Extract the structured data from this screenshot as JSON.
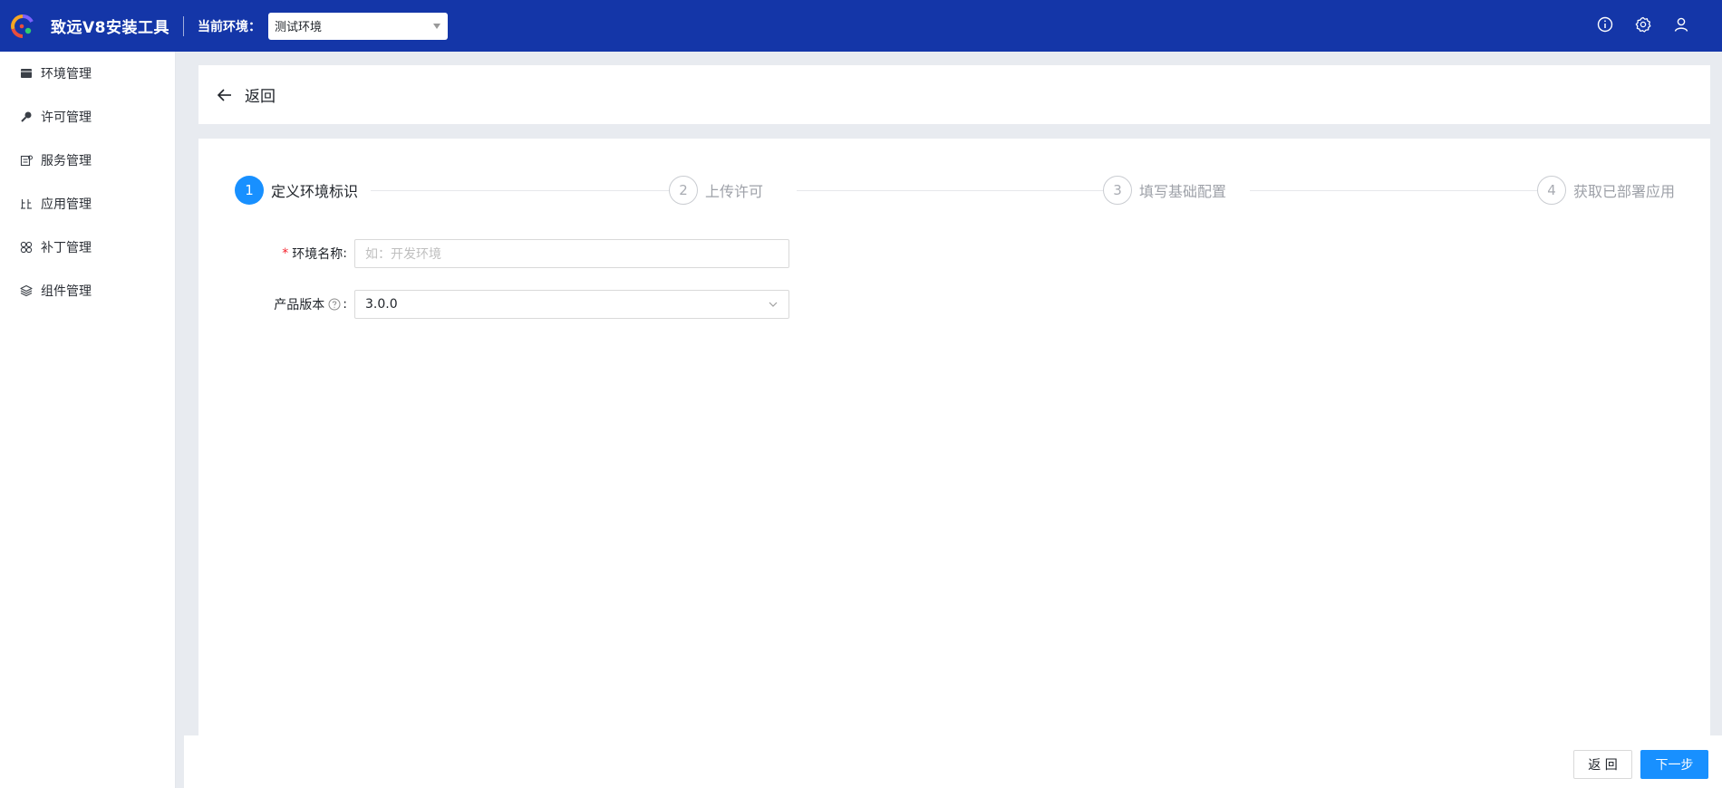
{
  "header": {
    "app_title": "致远V8安装工具",
    "env_label": "当前环境：",
    "env_value": "测试环境",
    "icons": [
      "info-icon",
      "settings-icon",
      "user-icon"
    ]
  },
  "sidebar": {
    "items": [
      {
        "label": "环境管理",
        "icon": "environment-icon"
      },
      {
        "label": "许可管理",
        "icon": "key-icon"
      },
      {
        "label": "服务管理",
        "icon": "service-icon"
      },
      {
        "label": "应用管理",
        "icon": "app-icon"
      },
      {
        "label": "补丁管理",
        "icon": "patch-icon"
      },
      {
        "label": "组件管理",
        "icon": "component-icon"
      }
    ]
  },
  "back": {
    "label": "返回"
  },
  "steps": [
    {
      "number": "1",
      "title": "定义环境标识",
      "status": "active"
    },
    {
      "number": "2",
      "title": "上传许可",
      "status": "wait"
    },
    {
      "number": "3",
      "title": "填写基础配置",
      "status": "wait"
    },
    {
      "number": "4",
      "title": "获取已部署应用",
      "status": "wait"
    }
  ],
  "form": {
    "env_name_label": "环境名称",
    "env_name_placeholder": "如：开发环境",
    "version_label": "产品版本",
    "version_value": "3.0.0",
    "colon": ":"
  },
  "footer": {
    "back_label": "返 回",
    "next_label": "下一步"
  },
  "colors": {
    "header_bg": "#1436a8",
    "primary": "#1890ff",
    "required": "#f5222d"
  }
}
